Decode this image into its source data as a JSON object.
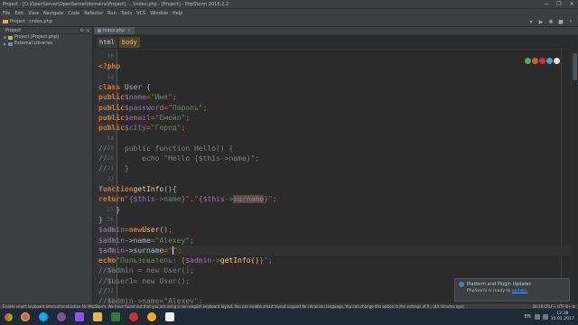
{
  "window": {
    "title": "Project - [D:\\OpenServer\\OpenServer\\domains\\Project] - ..\\index.php - [Project] - PhpStorm 2016.2.2",
    "controls": [
      "—",
      "❐",
      "✕"
    ]
  },
  "menu": [
    "File",
    "Edit",
    "View",
    "Navigate",
    "Code",
    "Refactor",
    "Run",
    "Tools",
    "VCS",
    "Window",
    "Help"
  ],
  "toolbar": {
    "breadcrumbs": [
      "Project",
      "index.php"
    ]
  },
  "project_panel": {
    "header": "Project",
    "items": [
      {
        "label": "Project [Project.php]",
        "expanded": true
      },
      {
        "label": "External Libraries",
        "expanded": false
      }
    ]
  },
  "tabs": [
    {
      "label": "index.php"
    }
  ],
  "editor": {
    "breadcrumb": [
      "html",
      "body"
    ],
    "lines": [
      {
        "n": "10",
        "text": ""
      },
      {
        "n": "11",
        "text": "<?php"
      },
      {
        "n": "12",
        "text": ""
      },
      {
        "n": "13",
        "text": "class User {"
      },
      {
        "n": "14",
        "text": "    public $name = \"Имя\";"
      },
      {
        "n": "15",
        "text": "    public $password = \"Пароль\";"
      },
      {
        "n": "16",
        "text": "    public $email = \"Емейл\";"
      },
      {
        "n": "17",
        "text": "    public $city = \"Город\";"
      },
      {
        "n": "18",
        "text": ""
      },
      {
        "n": "19",
        "text": "//    public function Hello() {"
      },
      {
        "n": "20",
        "text": "//        echo \"Hello {$this->name}\";"
      },
      {
        "n": "21",
        "text": "//    }"
      },
      {
        "n": "22",
        "text": ""
      },
      {
        "n": "23",
        "text": "    function getInfo() {"
      },
      {
        "n": "24",
        "text": "        return \"{$this->name}\". \"{$this->surname}\";"
      },
      {
        "n": "25",
        "text": "    }"
      },
      {
        "n": "26",
        "text": "}"
      },
      {
        "n": "26",
        "text": "$admin = new User();"
      },
      {
        "n": "27",
        "text": "$admin->name=\"Alexey\";"
      },
      {
        "n": "28",
        "text": "$admin->surname=\"\";"
      },
      {
        "n": "29",
        "text": "echo \"Пользователь: {$admin->getInfo()}\";"
      },
      {
        "n": "30",
        "text": "//$admin = new User();"
      },
      {
        "n": "31",
        "text": "//$user1= new User();"
      },
      {
        "n": "32",
        "text": "//"
      },
      {
        "n": "33",
        "text": "//$admin->name=\"Alexey\";"
      }
    ]
  },
  "notification": {
    "title": "Platform and Plugin Updates",
    "body_prefix": "PhpStorm is ready to",
    "body_link": "update."
  },
  "statusbar": {
    "message": "Enable smart keyboard internationalization for PhpStorm: We have found out that you are using a non-english keyboard layout. You can enable smart layout support for ukrainian language. You can change this option in the settings of P... (44 minutes ago)",
    "position": "28:18   CRLF÷   UTF-8÷   ⚙"
  },
  "taskbar": {
    "apps": [
      "chrome",
      "skype",
      "viber",
      "phpstorm",
      "folder",
      "media",
      "opera",
      "chrome2",
      "tool"
    ],
    "lang": "EN",
    "time": "12:38",
    "date": "15.01.2017"
  },
  "colors": {
    "keyword": "#cc7832",
    "string": "#6a8759",
    "variable": "#9876aa",
    "comment": "#808080",
    "function": "#ffc66d"
  }
}
